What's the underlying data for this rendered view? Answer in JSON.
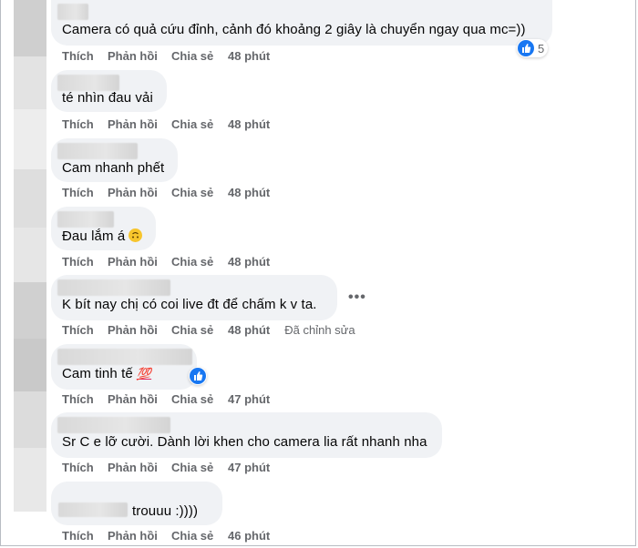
{
  "actions": {
    "like": "Thích",
    "reply": "Phản hồi",
    "share": "Chia sẻ",
    "edited": "Đã chỉnh sửa"
  },
  "comments": [
    {
      "text": "Camera có quả cứu đỉnh, cảnh đó khoảng 2 giây là chuyển ngay qua mc=))",
      "time": "48 phút",
      "reaction_icon": "like-icon",
      "reaction_count": "5"
    },
    {
      "text": "té nhìn đau vải",
      "time": "48 phút"
    },
    {
      "text": "Cam nhanh phết",
      "time": "48 phút"
    },
    {
      "text": "Đau lắm á",
      "emoji": "upside-down-face-icon",
      "time": "48 phút"
    },
    {
      "text": "K bít nay chị có coi live đt để chấm k v ta.",
      "time": "48 phút",
      "edited": true,
      "more_icon": "more-options-icon"
    },
    {
      "text": "Cam tinh tế",
      "emoji": "hundred-points-icon",
      "time": "47 phút",
      "reaction_icon": "like-icon"
    },
    {
      "text": "Sr C e lỡ cười. Dành lời khen cho camera lia rất nhanh nha",
      "time": "47 phút"
    },
    {
      "text": "trouuu :))))",
      "time": "46 phút"
    }
  ],
  "colors": {
    "bubble": "#f0f2f5",
    "action_text": "#65676b",
    "like_blue": "#1877f2"
  }
}
